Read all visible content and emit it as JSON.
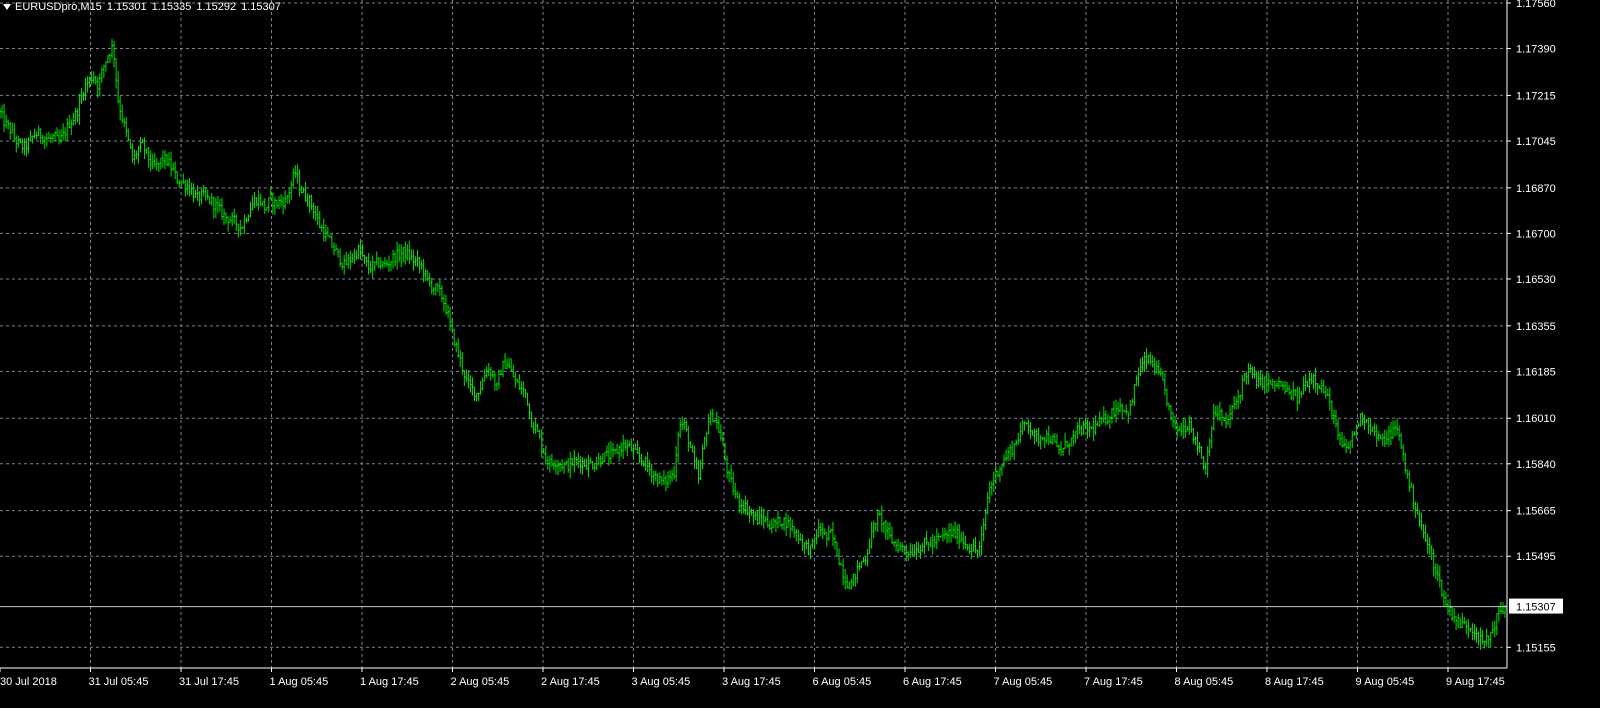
{
  "header": {
    "symbol": "EURUSDpro,M15",
    "open": "1.15301",
    "high": "1.15335",
    "low": "1.15292",
    "close": "1.15307"
  },
  "colors": {
    "background": "#000000",
    "axis": "#ffffff",
    "grid": "#77839a",
    "bars": "#00e400",
    "bid_line": "#c8c8c8"
  },
  "chart_data": {
    "type": "bar",
    "style": "ohlc",
    "grid": true,
    "ylim": [
      1.1513,
      1.1756
    ],
    "y_ticks": [
      "1.17560",
      "1.17390",
      "1.17215",
      "1.17045",
      "1.16870",
      "1.16700",
      "1.16530",
      "1.16355",
      "1.16185",
      "1.16010",
      "1.15840",
      "1.15665",
      "1.15495",
      "1.15155"
    ],
    "x_ticks": [
      "30 Jul 2018",
      "31 Jul 05:45",
      "31 Jul 17:45",
      "1 Aug 05:45",
      "1 Aug 17:45",
      "2 Aug 05:45",
      "2 Aug 17:45",
      "3 Aug 05:45",
      "3 Aug 17:45",
      "6 Aug 05:45",
      "6 Aug 17:45",
      "7 Aug 05:45",
      "7 Aug 17:45",
      "8 Aug 05:45",
      "8 Aug 17:45",
      "9 Aug 05:45",
      "9 Aug 17:45"
    ],
    "current_price": "1.15307",
    "series": [
      {
        "values": [
          1.1715,
          1.1711,
          1.1709,
          1.1705,
          1.1703,
          1.1702,
          1.1704,
          1.1707,
          1.1707,
          1.1706,
          1.1705,
          1.1706,
          1.1704,
          1.1707,
          1.1711,
          1.1713,
          1.1717,
          1.1724,
          1.1727,
          1.1729,
          1.1725,
          1.1732,
          1.1737,
          1.174,
          1.172,
          1.1712,
          1.1705,
          1.1697,
          1.1701,
          1.1703,
          1.1699,
          1.1695,
          1.1695,
          1.1698,
          1.1697,
          1.1694,
          1.169,
          1.1689,
          1.1688,
          1.1686,
          1.1683,
          1.1684,
          1.1683,
          1.1682,
          1.168,
          1.1678,
          1.1676,
          1.1675,
          1.1674,
          1.1672,
          1.1676,
          1.168,
          1.1683,
          1.1682,
          1.1679,
          1.1683,
          1.1681,
          1.1682,
          1.1682,
          1.1687,
          1.1693,
          1.1687,
          1.1684,
          1.1682,
          1.1678,
          1.1673,
          1.167,
          1.1667,
          1.1664,
          1.1661,
          1.1658,
          1.166,
          1.1662,
          1.1664,
          1.166,
          1.1657,
          1.1658,
          1.1659,
          1.1658,
          1.1659,
          1.1661,
          1.1662,
          1.1663,
          1.1662,
          1.166,
          1.1659,
          1.1657,
          1.1652,
          1.165,
          1.1649,
          1.1646,
          1.164,
          1.1632,
          1.1626,
          1.162,
          1.1614,
          1.1612,
          1.161,
          1.1614,
          1.162,
          1.1618,
          1.1612,
          1.162,
          1.1622,
          1.1618,
          1.1614,
          1.1612,
          1.161,
          1.16,
          1.1597,
          1.1592,
          1.1586,
          1.1584,
          1.1585,
          1.1584,
          1.1583,
          1.1584,
          1.1585,
          1.1585,
          1.1584,
          1.1584,
          1.1584,
          1.1586,
          1.1587,
          1.1587,
          1.1588,
          1.159,
          1.1591,
          1.159,
          1.1588,
          1.1586,
          1.1585,
          1.1582,
          1.158,
          1.1578,
          1.1577,
          1.1579,
          1.158,
          1.1598,
          1.1599,
          1.1593,
          1.1585,
          1.1578,
          1.159,
          1.16,
          1.1602,
          1.1598,
          1.159,
          1.158,
          1.1575,
          1.157,
          1.1569,
          1.1567,
          1.1565,
          1.1563,
          1.1564,
          1.1562,
          1.1561,
          1.1562,
          1.1563,
          1.1562,
          1.156,
          1.1558,
          1.1555,
          1.1553,
          1.1552,
          1.1558,
          1.156,
          1.1556,
          1.1558,
          1.1552,
          1.1546,
          1.154,
          1.1539,
          1.1543,
          1.1547,
          1.1549,
          1.1556,
          1.1563,
          1.1564,
          1.156,
          1.1556,
          1.1554,
          1.1553,
          1.1552,
          1.1551,
          1.1552,
          1.1553,
          1.1554,
          1.1554,
          1.1555,
          1.1556,
          1.1557,
          1.1558,
          1.1558,
          1.1557,
          1.1555,
          1.1553,
          1.1552,
          1.1551,
          1.156,
          1.1574,
          1.1578,
          1.1582,
          1.1585,
          1.1588,
          1.159,
          1.1594,
          1.1598,
          1.16,
          1.1595,
          1.1593,
          1.1595,
          1.1594,
          1.1593,
          1.1589,
          1.1589,
          1.1592,
          1.1593,
          1.1596,
          1.1597,
          1.1597,
          1.1597,
          1.1598,
          1.16,
          1.1601,
          1.1603,
          1.1605,
          1.1606,
          1.1603,
          1.1605,
          1.1616,
          1.162,
          1.1623,
          1.1622,
          1.1619,
          1.1616,
          1.161,
          1.1602,
          1.1597,
          1.1597,
          1.1598,
          1.16,
          1.1592,
          1.159,
          1.158,
          1.1595,
          1.1603,
          1.1603,
          1.1598,
          1.1602,
          1.1606,
          1.161,
          1.1617,
          1.1619,
          1.1616,
          1.1614,
          1.1615,
          1.1614,
          1.1613,
          1.1614,
          1.1612,
          1.161,
          1.161,
          1.1608,
          1.1613,
          1.1615,
          1.1617,
          1.1614,
          1.1612,
          1.1608,
          1.1603,
          1.1594,
          1.159,
          1.159,
          1.1594,
          1.1599,
          1.1602,
          1.16,
          1.1597,
          1.1594,
          1.1592,
          1.1594,
          1.1596,
          1.1597,
          1.159,
          1.158,
          1.1573,
          1.1567,
          1.156,
          1.1555,
          1.155,
          1.1544,
          1.1538,
          1.1531,
          1.1529,
          1.1526,
          1.1524,
          1.1524,
          1.1523,
          1.1522,
          1.1518,
          1.1517,
          1.152,
          1.1525,
          1.1529,
          1.153
        ]
      }
    ]
  }
}
